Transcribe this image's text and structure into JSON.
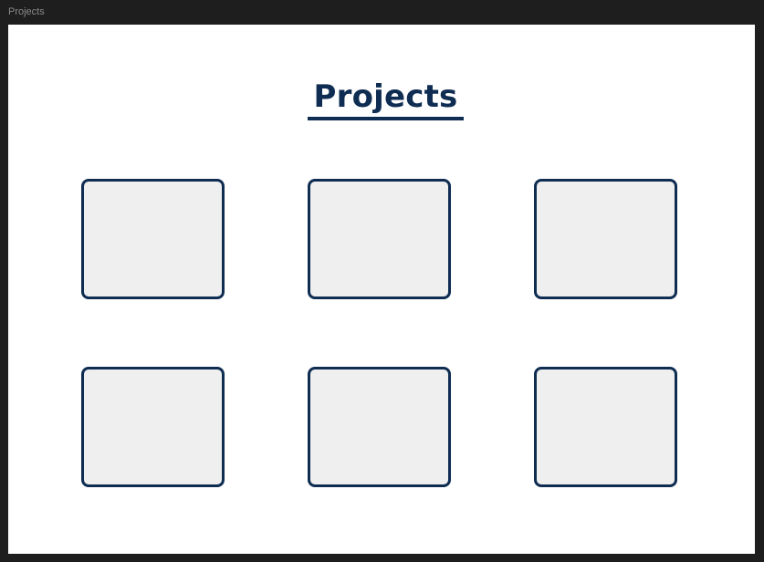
{
  "frame": {
    "label": "Projects"
  },
  "page": {
    "title": "Projects"
  },
  "projects": {
    "card_count": 6
  },
  "colors": {
    "accent": "#0f2d52",
    "card_fill": "#efefef",
    "canvas": "#ffffff",
    "workspace": "#1e1e1e"
  }
}
